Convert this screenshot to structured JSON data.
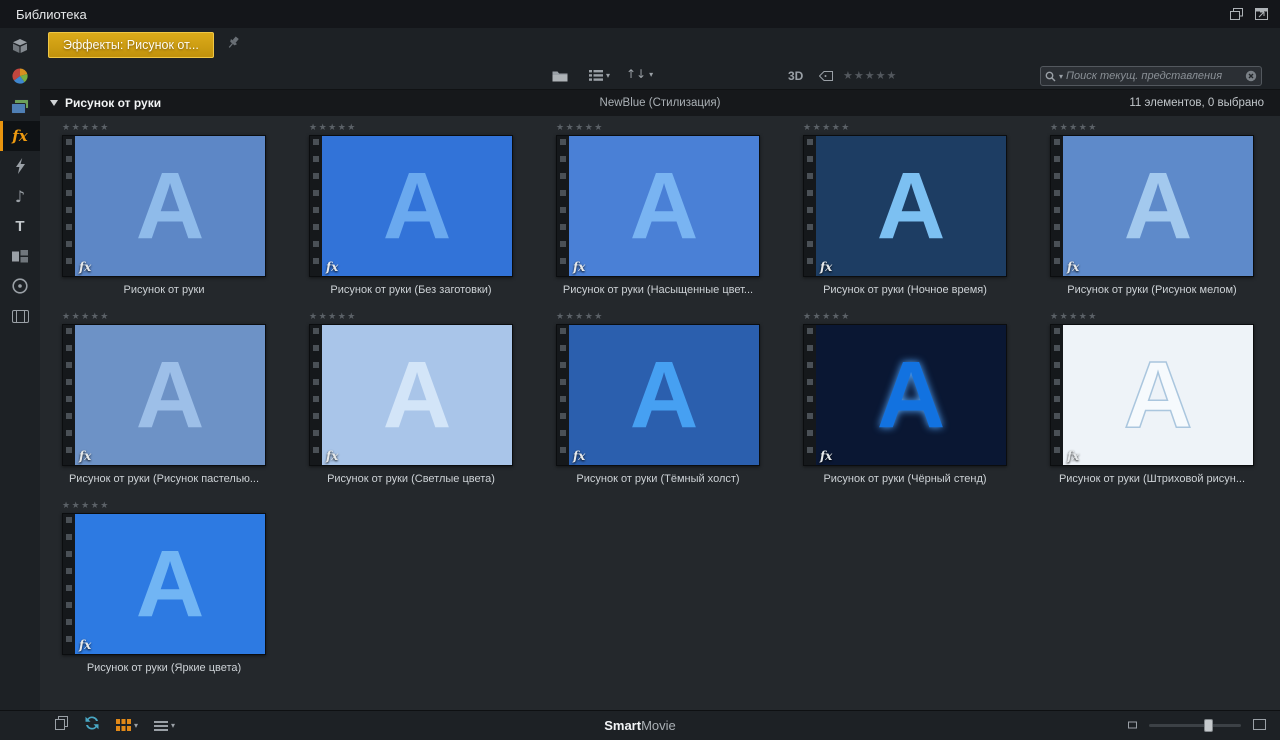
{
  "window": {
    "title": "Библиотека"
  },
  "tabbar": {
    "active_tab": "Эффекты: Рисунок от..."
  },
  "toolbar": {
    "three_d_label": "3D",
    "rating_stars": "★★★★★",
    "search_placeholder": "Поиск текущ. представления"
  },
  "glyphs": {
    "caret": "▾",
    "sort_arrows": "↑↓",
    "music_note": "♪",
    "fx": "fx",
    "titles": "T"
  },
  "section_header": {
    "title": "Рисунок от руки",
    "provider": "NewBlue (Стилизация)",
    "status": "11 элементов, 0 выбрано"
  },
  "sidebar": {
    "active_index": 3,
    "icons": [
      "box-icon",
      "collections-icon",
      "media-icon",
      "effects-fx-icon",
      "transitions-icon",
      "music-icon",
      "titles-icon",
      "montage-icon",
      "disc-menu-icon",
      "filmstrip-icon"
    ]
  },
  "grid": {
    "stars": "★★★★★",
    "letter": "A",
    "fx_badge": "fx",
    "items": [
      {
        "label": "Рисунок от руки",
        "bg": "#5d87c6",
        "letter_color": "#8fbbea"
      },
      {
        "label": "Рисунок от руки (Без заготовки)",
        "bg": "#3273d8",
        "letter_color": "#6aa9ef"
      },
      {
        "label": "Рисунок от руки (Насыщенные цвет...",
        "bg": "#4a80d6",
        "letter_color": "#79b4f2"
      },
      {
        "label": "Рисунок от руки (Ночное время)",
        "bg": "#1d3d63",
        "letter_color": "#7cc0f2"
      },
      {
        "label": "Рисунок от руки (Рисунок мелом)",
        "bg": "#5e8aca",
        "letter_color": "#a3c9ee"
      },
      {
        "label": "Рисунок от руки (Рисунок пастелью...",
        "bg": "#6d92c6",
        "letter_color": "#9dbfe8"
      },
      {
        "label": "Рисунок от руки (Светлые цвета)",
        "bg": "#a9c5e9",
        "letter_color": "#d3e5f8"
      },
      {
        "label": "Рисунок от руки (Тёмный холст)",
        "bg": "#2b5fae",
        "letter_color": "#46a0f2"
      },
      {
        "label": "Рисунок от руки (Чёрный стенд)",
        "bg": "#0a1733",
        "letter_color": "#1272e0",
        "letter_glow": "#54a8ff"
      },
      {
        "label": "Рисунок от руки (Штриховой рисун...",
        "bg": "#eef3f8",
        "letter_color": "#f6fafd",
        "letter_stroke": "#aac6de"
      },
      {
        "label": "Рисунок от руки (Яркие цвета)",
        "bg": "#2d7ae2",
        "letter_color": "#71b5f4"
      }
    ]
  },
  "bottombar": {
    "brand_bold": "Smart",
    "brand_rest": "Movie"
  }
}
